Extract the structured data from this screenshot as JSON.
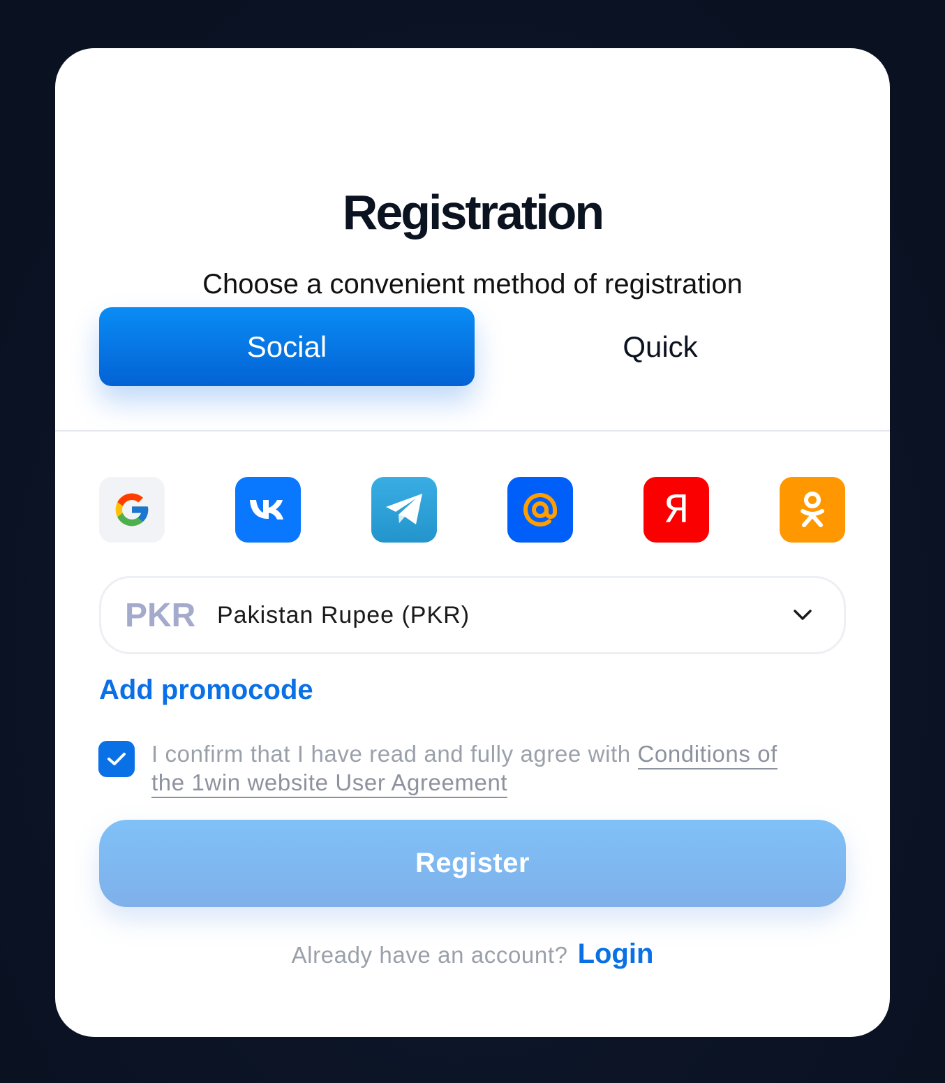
{
  "modal": {
    "title": "Registration",
    "subtitle": "Choose a convenient method of registration"
  },
  "tabs": [
    {
      "label": "Social",
      "active": true
    },
    {
      "label": "Quick",
      "active": false
    }
  ],
  "socials": [
    {
      "icon": "google-icon"
    },
    {
      "icon": "vk-icon"
    },
    {
      "icon": "telegram-icon"
    },
    {
      "icon": "mailru-icon"
    },
    {
      "icon": "yandex-icon",
      "glyph": "Я"
    },
    {
      "icon": "odnoklassniki-icon"
    }
  ],
  "currency": {
    "code": "PKR",
    "name": "Pakistan Rupee (PKR)"
  },
  "promo": {
    "label": "Add promocode"
  },
  "agreement": {
    "checked": true,
    "text": "I confirm that I have read and fully agree with ",
    "link1": "Conditions of",
    "link2": "the 1win website User Agreement"
  },
  "register": {
    "label": "Register"
  },
  "footer": {
    "text": "Already have an account?",
    "login": "Login"
  },
  "colors": {
    "accent": "#0a70e6",
    "social_tab": "#0362d4",
    "register": "#7fb0ea",
    "backdrop": "#0c1426"
  }
}
